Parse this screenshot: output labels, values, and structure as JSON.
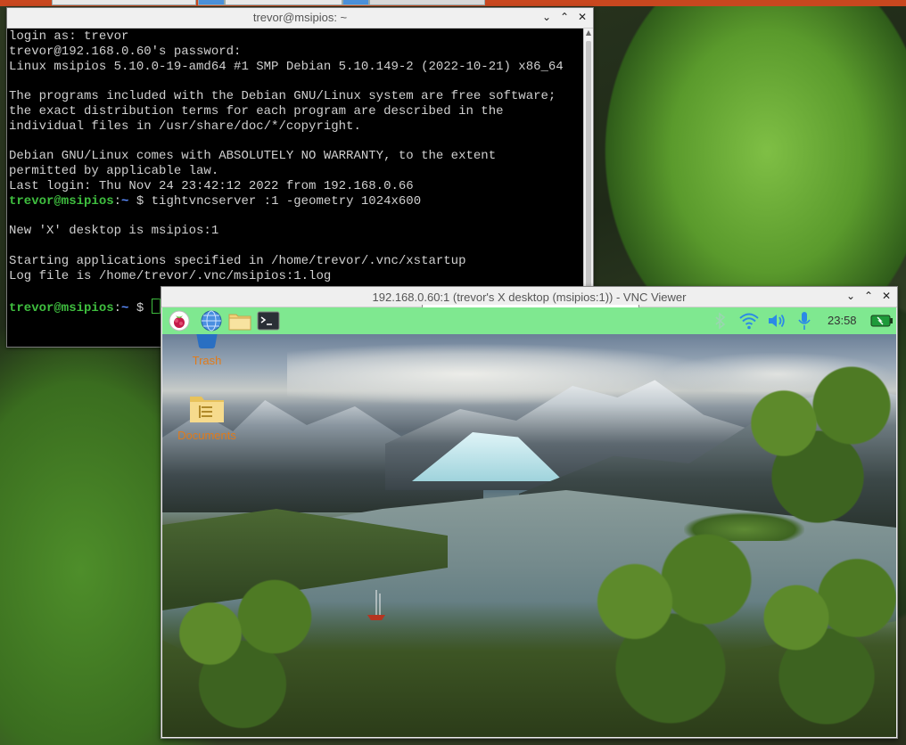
{
  "host_desktop": {
    "top_tabs": [
      "",
      "",
      "",
      ""
    ]
  },
  "terminal": {
    "title": "trevor@msipios: ~",
    "lines": [
      "login as: trevor",
      "trevor@192.168.0.60's password:",
      "Linux msipios 5.10.0-19-amd64 #1 SMP Debian 5.10.149-2 (2022-10-21) x86_64",
      "",
      "The programs included with the Debian GNU/Linux system are free software;",
      "the exact distribution terms for each program are described in the",
      "individual files in /usr/share/doc/*/copyright.",
      "",
      "Debian GNU/Linux comes with ABSOLUTELY NO WARRANTY, to the extent",
      "permitted by applicable law.",
      "Last login: Thu Nov 24 23:42:12 2022 from 192.168.0.66"
    ],
    "prompt_user": "trevor@msipios",
    "prompt_sep": ":",
    "prompt_path": "~",
    "prompt_symbol": " $ ",
    "command": "tightvncserver :1 -geometry 1024x600",
    "output_lines": [
      "",
      "New 'X' desktop is msipios:1",
      "",
      "Starting applications specified in /home/trevor/.vnc/xstartup",
      "Log file is /home/trevor/.vnc/msipios:1.log",
      ""
    ]
  },
  "vnc": {
    "title": "192.168.0.60:1 (trevor's X desktop (msipios:1)) - VNC Viewer",
    "clock": "23:58",
    "desktop_icons": [
      {
        "label": "Trash",
        "icon": "trash-icon"
      },
      {
        "label": "Documents",
        "icon": "folder-icon"
      }
    ],
    "panel_icons": [
      "raspberry-menu-icon",
      "web-browser-icon",
      "file-manager-icon",
      "terminal-icon"
    ],
    "tray_icons": [
      "bluetooth-icon",
      "wifi-icon",
      "volume-icon",
      "microphone-icon",
      "battery-icon"
    ],
    "colors": {
      "panel": "#7fe890",
      "label": "#e07b1a",
      "tray": "#2b8ae6"
    }
  },
  "window_controls": {
    "minimize": "⌄",
    "maximize": "⌃",
    "close": "✕"
  }
}
